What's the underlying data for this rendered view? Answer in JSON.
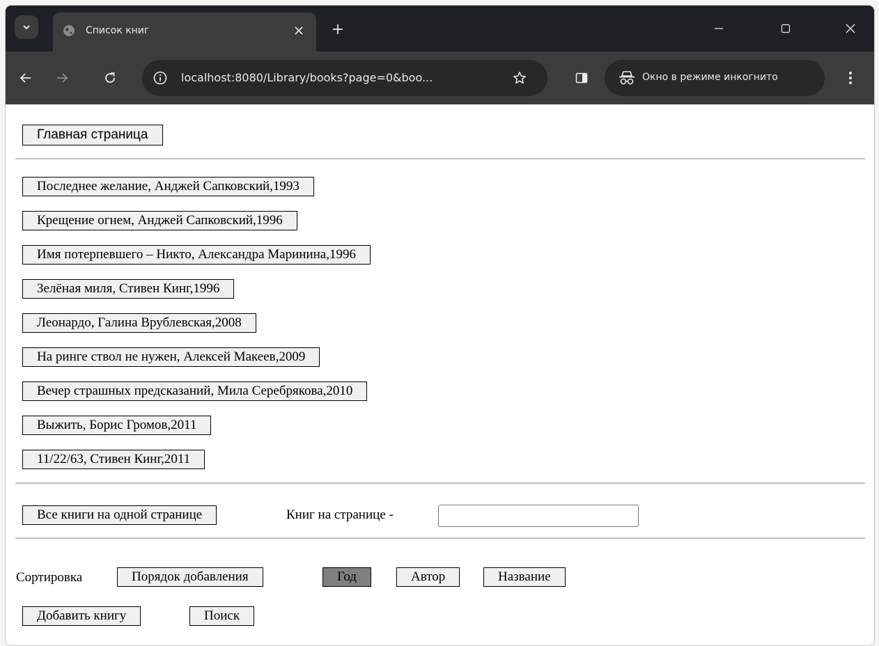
{
  "browser": {
    "tab": {
      "title": "Список книг",
      "favicon": "globe-icon",
      "close_icon": "close-icon"
    },
    "new_tab_icon": "plus-icon",
    "window_controls": [
      "minimize-icon",
      "maximize-icon",
      "close-icon"
    ],
    "address": "localhost:8080/Library/books?page=0&boo...",
    "incognito_label": "Окно в режиме инкогнито"
  },
  "page": {
    "home_button": "Главная страница",
    "books": [
      "Последнее желание, Анджей Сапковский,1993",
      "Крещение огнем, Анджей Сапковский,1996",
      "Имя потерпевшего – Никто, Александра Маринина,1996",
      "Зелёная миля, Стивен Кинг,1996",
      "Леонардо, Галина Врублевская,2008",
      "На ринге ствол не нужен, Алексей Макеев,2009",
      "Вечер страшных предсказаний, Мила Серебрякова,2010",
      "Выжить, Борис Громов,2011",
      "11/22/63, Стивен Кинг,2011"
    ],
    "all_books_button": "Все книги на одной странице",
    "per_page_label": "Книг на странице -",
    "per_page_value": "",
    "sort_label": "Сортировка",
    "sort_options": [
      "Порядок добавления",
      "Год",
      "Автор",
      "Название"
    ],
    "sort_active": "Год",
    "add_book_button": "Добавить книгу",
    "search_button": "Поиск"
  },
  "colors": {
    "chrome_dark": "#202124",
    "toolbar": "#3c3c3c",
    "button_bg": "#f0f0f0",
    "active_sort_bg": "#808080"
  }
}
